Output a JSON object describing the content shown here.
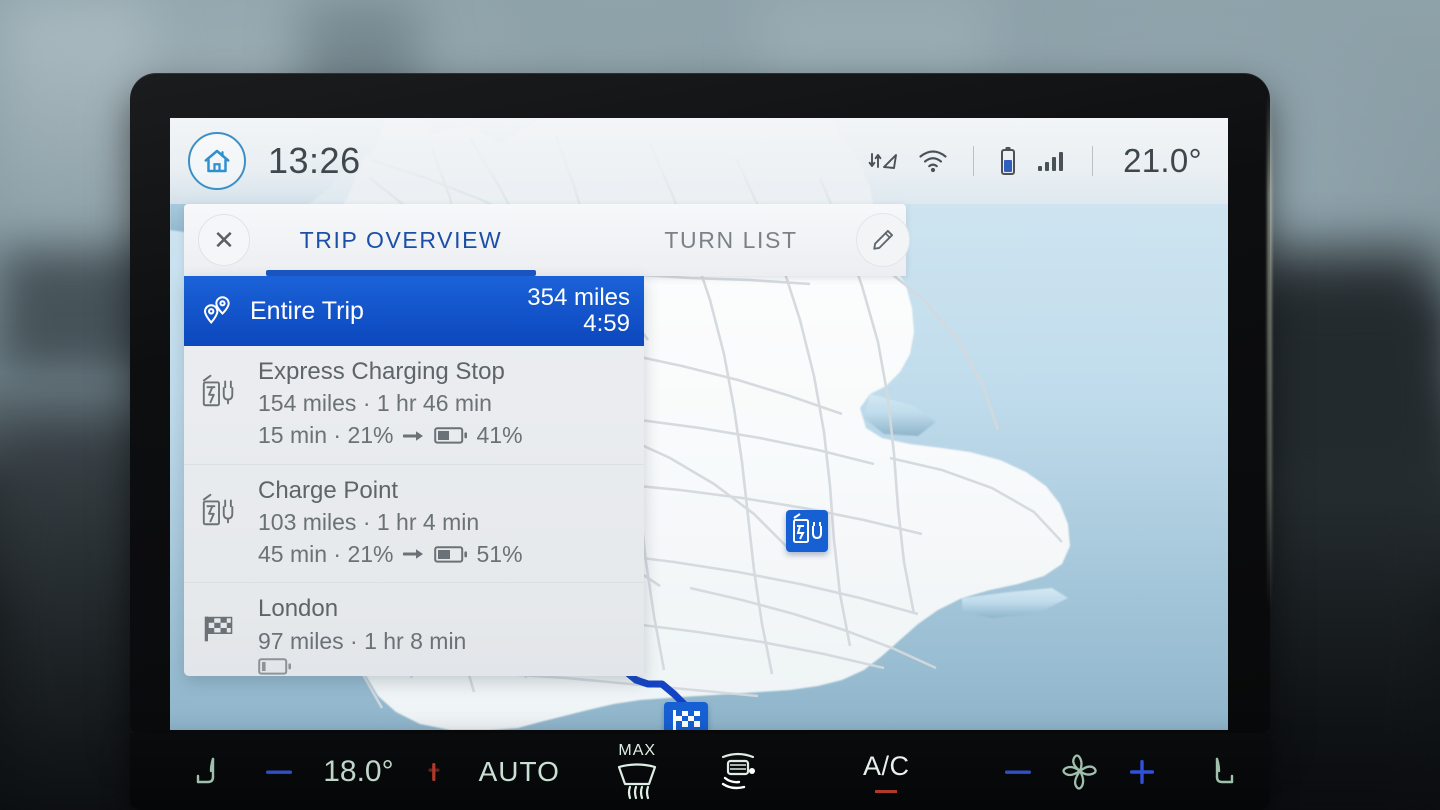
{
  "statusbar": {
    "home_icon": "home-icon",
    "clock": "13:26",
    "nav_icon": "navigation-arrow-updown-icon",
    "wifi_icon": "wifi-icon",
    "battery_icon": "battery-icon",
    "signal_icon": "cellular-signal-icon",
    "temperature": "21.0°"
  },
  "tabbar": {
    "close_label": "✕",
    "close_icon": "close-icon",
    "edit_icon": "pencil-edit-icon",
    "tabs": [
      {
        "label": "TRIP OVERVIEW",
        "active": true
      },
      {
        "label": "TURN LIST",
        "active": false
      }
    ]
  },
  "trip": {
    "entire": {
      "icon": "route-waypoints-icon",
      "label": "Entire Trip",
      "distance": "354 miles",
      "duration": "4:59"
    },
    "stops": [
      {
        "icon": "ev-charging-station-icon",
        "name": "Express Charging Stop",
        "meta": "154 miles · 1 hr 46 min",
        "charge_time": "15 min · 21%",
        "arrow_icon": "arrow-right-icon",
        "battery_icon": "battery-half-icon",
        "battery_level_pct": 41,
        "charge_target": "41%"
      },
      {
        "icon": "ev-charging-station-icon",
        "name": "Charge Point",
        "meta": "103 miles · 1 hr 4 min",
        "charge_time": "45 min · 21%",
        "arrow_icon": "arrow-right-icon",
        "battery_icon": "battery-half-icon",
        "battery_level_pct": 51,
        "charge_target": "51%"
      },
      {
        "icon": "checkered-flag-icon",
        "name": "London",
        "meta": "97 miles · 1 hr 8 min",
        "charge_time": "",
        "arrow_icon": "",
        "battery_icon": "battery-low-icon",
        "battery_level_pct": 10,
        "charge_target": ""
      }
    ]
  },
  "map": {
    "vehicle_marker_icon": "vehicle-position-arrow-icon",
    "charge_marker_1_icon": "ev-charging-map-pin-icon",
    "charge_marker_2_icon": "ev-charging-map-pin-icon",
    "destination_marker_icon": "checkered-flag-map-pin-icon",
    "route_color": "#1443c4",
    "land_color": "#fbfcfd",
    "water_color": "#bcd8e8"
  },
  "climate": {
    "seat_left_icon": "heated-seat-left-icon",
    "temp_minus_icon": "minus-icon",
    "temperature": "18.0°",
    "temp_plus_icon": "plus-icon",
    "auto_label": "AUTO",
    "defrost_max_label": "MAX",
    "defrost_icon": "front-defrost-icon",
    "rear_defrost_icon": "rear-defrost-icon",
    "ac_label": "A/C",
    "fan_minus_icon": "minus-icon",
    "fan_icon": "fan-icon",
    "fan_plus_icon": "plus-icon",
    "seat_right_icon": "heated-seat-right-icon"
  },
  "colors": {
    "accent_blue": "#1a55c4",
    "selected_row": "#0c47bd",
    "tab_active_text": "#1b4fa8",
    "status_text": "#40474d",
    "panel_bg": "#eceef1",
    "climate_bar": "#07090b",
    "climate_text": "#c9e0d3"
  }
}
